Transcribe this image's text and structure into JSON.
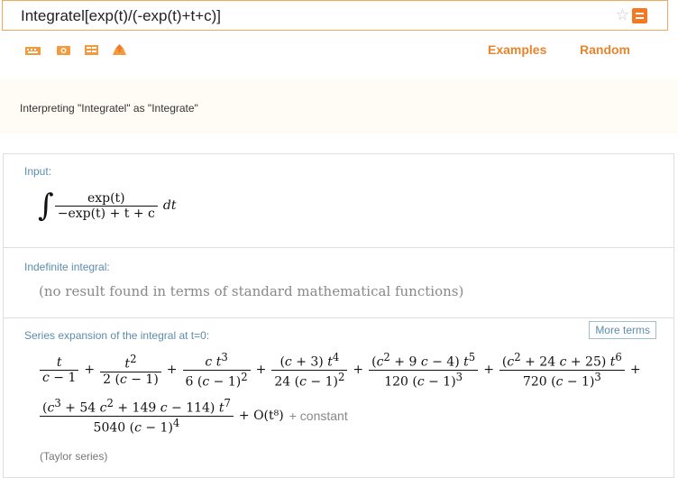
{
  "search": {
    "query": "Integratel[exp(t)/(-exp(t)+t+c)]"
  },
  "toolbar": {
    "examples_label": "Examples",
    "random_label": "Random"
  },
  "notice": {
    "text": "Interpreting \"Integratel\" as \"Integrate\""
  },
  "pods": {
    "input": {
      "title": "Input:",
      "numerator": "exp(t)",
      "denominator": "−exp(t) + t + c",
      "differential": "dt"
    },
    "indefinite": {
      "title": "Indefinite integral:",
      "result": "(no result found in terms of standard mathematical functions)"
    },
    "series": {
      "title": "Series expansion of the integral at t=0:",
      "more_terms_label": "More terms",
      "tail": "+ O(t⁸)",
      "constant": "+ constant",
      "footnote": "(Taylor series)"
    }
  },
  "colors": {
    "accent": "#f37a22",
    "pod_title": "#5b8dac",
    "link": "#e8842c"
  }
}
